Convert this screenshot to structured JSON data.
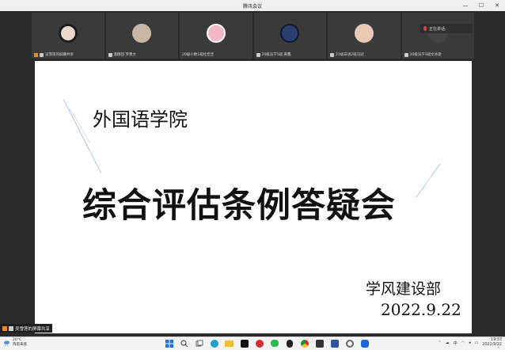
{
  "window": {
    "title": "腾讯会议",
    "controls": [
      "—",
      "☐",
      "✕"
    ]
  },
  "participants": [
    {
      "name": "吴雪莲的屏幕共享",
      "avatar_color": "#e9d9cc",
      "sharing": true
    },
    {
      "name": "酒精团 罗勇文",
      "avatar_color": "#c9b6a5",
      "sharing": false
    },
    {
      "name": "20级小数1班杜佳佳",
      "avatar_color": "#f2b8c6",
      "sharing": false
    },
    {
      "name": "20级法学1班 黄鑫",
      "avatar_color": "#2c3e70",
      "sharing": false
    },
    {
      "name": "21级日语2班冯冠",
      "avatar_color": "#e8c7b5",
      "sharing": false
    },
    {
      "name": "20级法学3班文冰艳",
      "avatar_color": "#444444",
      "sharing": false
    }
  ],
  "speaking_label": "正在讲话:",
  "slide": {
    "school": "外国语学院",
    "heading": "综合评估条例答疑会",
    "department": "学风建设部",
    "date": "2022.9.22"
  },
  "share_badge": "吴雪莲的屏幕共享",
  "taskbar": {
    "weather_temp": "20°C",
    "weather_desc": "阵雨来袭",
    "apps": [
      {
        "icon": "windows-icon",
        "color": "#1e73d8"
      },
      {
        "icon": "search-icon",
        "color": "#333333"
      },
      {
        "icon": "task-view-icon",
        "color": "#555555"
      },
      {
        "icon": "edge-icon",
        "color": "#1aa0c9"
      },
      {
        "icon": "file-explorer-icon",
        "color": "#f2c02e"
      },
      {
        "icon": "capcut-icon",
        "color": "#111111"
      },
      {
        "icon": "netease-music-icon",
        "color": "#d8282c"
      },
      {
        "icon": "wechat-icon",
        "color": "#2dbb4e"
      },
      {
        "icon": "qq-icon",
        "color": "#222222"
      },
      {
        "icon": "chrome-icon",
        "color": "#e0a319"
      },
      {
        "icon": "media-icon",
        "color": "#333333"
      },
      {
        "icon": "word-icon",
        "color": "#2b579a"
      },
      {
        "icon": "settings-icon",
        "color": "#666666"
      },
      {
        "icon": "tencent-meeting-icon",
        "color": "#1667d9"
      }
    ],
    "tray_lang": "中",
    "time": "19:33",
    "date": "2022/9/22"
  }
}
